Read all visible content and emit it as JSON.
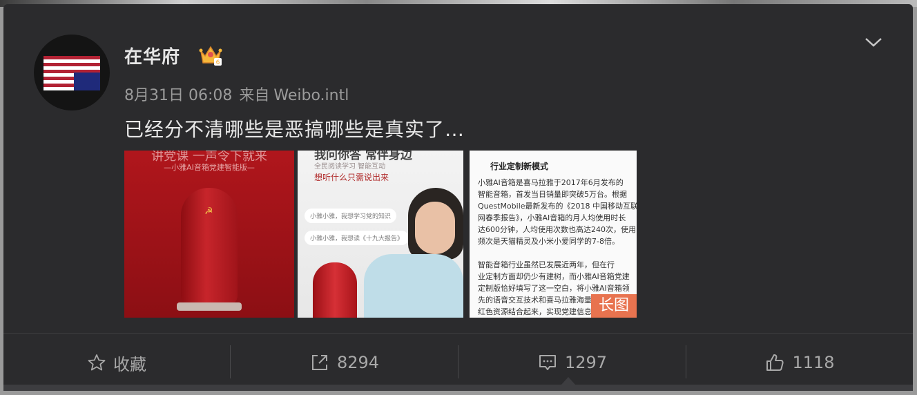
{
  "post": {
    "username": "在华府",
    "date": "8月31日 06:08",
    "source_prefix": "来自",
    "source": "Weibo.intl",
    "text": "已经分不清哪些是恶搞哪些是真实了…",
    "images": [
      {
        "heading": "讲党课 一声令下就来",
        "subheading": "—小雅AI音箱党建智能版—"
      },
      {
        "heading": "我问你答 常伴身边",
        "subheading": "全民阅读学习 智能互动",
        "line3": "想听什么只需说出来",
        "bubble1": "小雅小雅，我想学习党的知识",
        "bubble2": "小雅小雅，我想读《十九大报告》"
      },
      {
        "heading": "行业定制新模式",
        "lines": [
          "小雅AI音箱是喜马拉雅于2017年6月发布的",
          "智能音箱，首发当日销量即突破5万台。根据",
          "QuestMobile最新发布的《2018 中国移动互联",
          "网春季报告》，小雅AI音箱的月人均使用时长",
          "达600分钟，人均使用次数也高达240次，使用",
          "频次是天猫精灵及小米小爱同学的7-8倍。",
          "",
          "智能音箱行业虽然已发展近两年，但在行",
          "业定制方面却仍少有建树，而小雅AI音箱党建",
          "定制版恰好填写了这一空白，将小雅AI音箱领",
          "先的语音交互技术和喜马拉雅海量丰富优质的",
          "红色资源结合起来，实现党建信息化"
        ],
        "badge": "长图"
      }
    ]
  },
  "actions": {
    "favorite_label": "收藏",
    "repost_count": "8294",
    "comment_count": "1297",
    "like_count": "1118"
  },
  "colors": {
    "card_bg": "#2b2b2d",
    "accent_badge": "#e8734f",
    "text_primary": "#e8e8e8",
    "text_secondary": "#9b9b9b"
  }
}
